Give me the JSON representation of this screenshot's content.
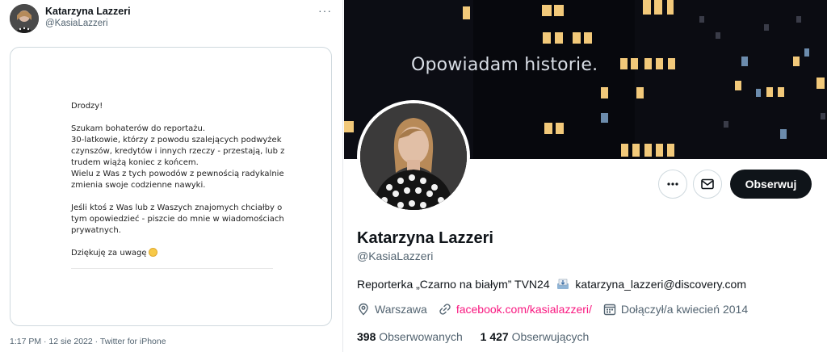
{
  "tweet": {
    "author_name": "Katarzyna Lazzeri",
    "author_handle": "@KasiaLazzeri",
    "more_label": "···",
    "letter": {
      "greeting": "Drodzy!",
      "p1_l1": "Szukam bohaterów do reportażu.",
      "p1_l2": "30-latkowie, którzy z powodu szalejących podwyżek",
      "p1_l3": "czynszów, kredytów i innych rzeczy - przestają, lub z",
      "p1_l4": "trudem wiążą koniec z końcem.",
      "p1_l5": "Wielu z Was z tych powodów z pewnością radykalnie",
      "p1_l6": "zmienia swoje codzienne nawyki.",
      "p2_l1": "Jeśli ktoś z Was lub z Waszych znajomych chciałby o",
      "p2_l2": "tym opowiedzieć - piszcie do mnie w wiadomościach",
      "p2_l3": "prywatnych.",
      "thanks": "Dziękuję za uwagę"
    },
    "timestamp": "1:17 PM · 12 sie 2022 · Twitter for iPhone"
  },
  "profile": {
    "banner_text": "Opowiadam historie.",
    "follow_label": "Obserwuj",
    "name": "Katarzyna Lazzeri",
    "handle": "@KasiaLazzeri",
    "bio_before": "Reporterka „Czarno na białym” TVN24",
    "bio_after": "katarzyna_lazzeri@discovery.com",
    "location": "Warszawa",
    "website": "facebook.com/kasialazzeri/",
    "joined": "Dołączył/a kwiecień 2014",
    "following_count": "398",
    "following_label": "Obserwowanych",
    "followers_count": "1 427",
    "followers_label": "Obserwujących"
  },
  "colors": {
    "link": "#f91880",
    "secondary_text": "#536471",
    "follow_button": "#0f1419"
  },
  "icons": {
    "more": "more-icon",
    "mail": "mail-icon",
    "location": "location-icon",
    "link": "link-icon",
    "calendar": "calendar-icon",
    "inbox": "inbox-tray-icon",
    "smile": "smiling-face-icon"
  }
}
